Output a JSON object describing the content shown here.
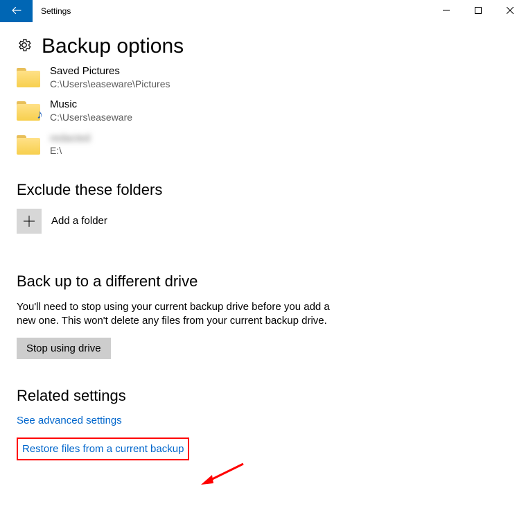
{
  "window": {
    "title": "Settings"
  },
  "header": {
    "page_title": "Backup options"
  },
  "folders": [
    {
      "name": "Saved Pictures",
      "path": "C:\\Users\\easeware\\Pictures",
      "variant": "plain"
    },
    {
      "name": "Music",
      "path": "C:\\Users\\easeware",
      "variant": "music"
    },
    {
      "name": "redacted",
      "path": "E:\\",
      "variant": "blurred"
    }
  ],
  "exclude": {
    "heading": "Exclude these folders",
    "add_label": "Add a folder"
  },
  "different_drive": {
    "heading": "Back up to a different drive",
    "body": "You'll need to stop using your current backup drive before you add a new one. This won't delete any files from your current backup drive.",
    "button": "Stop using drive"
  },
  "related": {
    "heading": "Related settings",
    "advanced_link": "See advanced settings",
    "restore_link": "Restore files from a current backup"
  }
}
